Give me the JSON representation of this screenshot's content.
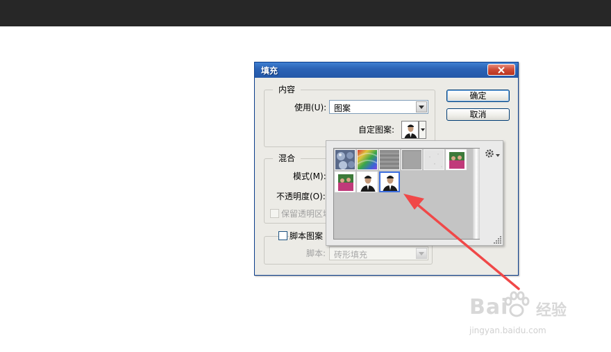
{
  "dialog": {
    "title": "填充",
    "ok_label": "确定",
    "cancel_label": "取消"
  },
  "content_group": {
    "label": "内容",
    "use_label": "使用(U):",
    "use_value": "图案",
    "custom_pattern_label": "自定图案:"
  },
  "blend_group": {
    "label": "混合",
    "mode_label": "模式(M):",
    "opacity_label": "不透明度(O):",
    "preserve_transparency_label": "保留透明区域"
  },
  "script_group": {
    "label": "脚本图案",
    "script_label": "脚本:",
    "script_value": "砖形填充"
  },
  "pattern_picker": {
    "tiles": [
      {
        "name": "bubbles",
        "selected": false
      },
      {
        "name": "tie-dye",
        "selected": false
      },
      {
        "name": "gray-granite",
        "selected": false
      },
      {
        "name": "gray-fabric",
        "selected": false
      },
      {
        "name": "white-paper",
        "selected": false
      },
      {
        "name": "photo-group",
        "selected": false
      },
      {
        "name": "photo-group-2",
        "selected": false
      },
      {
        "name": "portrait-man-1",
        "selected": false
      },
      {
        "name": "portrait-man-2",
        "selected": true
      }
    ]
  },
  "watermark": {
    "logo": "Bai",
    "suffix": "经验",
    "site": "jingyan.baidu.com"
  },
  "colors": {
    "title_bar": "#2b63b6",
    "selection": "#3d6fe0",
    "annotation_arrow": "#f04848"
  }
}
